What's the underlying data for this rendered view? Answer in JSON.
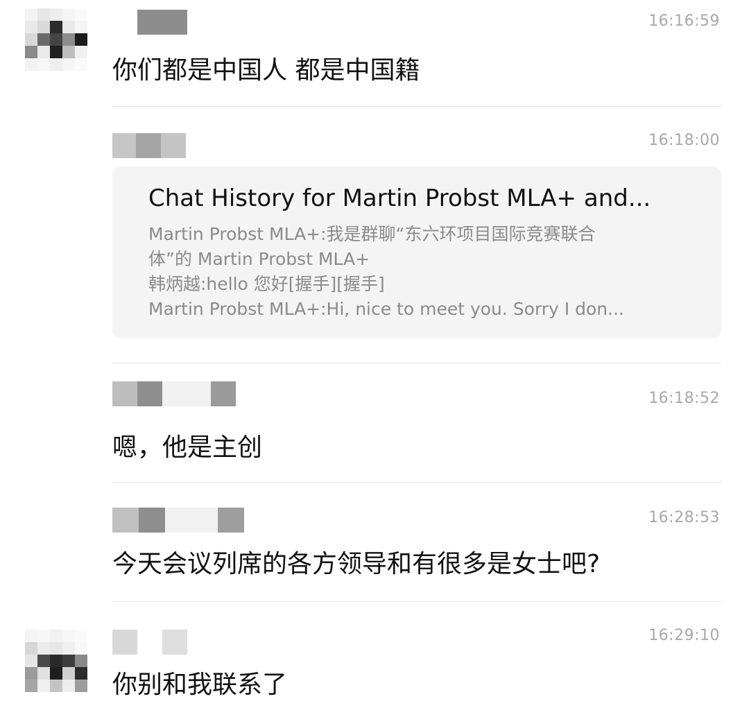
{
  "messages": [
    {
      "time": "16:16:59",
      "text": "你们都是中国人  都是中国籍"
    },
    {
      "time": "16:18:00",
      "card": {
        "title": "Chat History for Martin Probst MLA+ and...",
        "lines": [
          "Martin Probst MLA+:我是群聊“东六环项目国际竞赛联合",
          "体”的 Martin Probst MLA+",
          "韩炳越:hello  您好[握手][握手]",
          "Martin Probst MLA+:Hi, nice to meet you. Sorry I don..."
        ]
      }
    },
    {
      "time": "16:18:52",
      "text": "嗯，他是主创"
    },
    {
      "time": "16:28:53",
      "text": "今天会议列席的各方领导和有很多是女士吧?"
    },
    {
      "time": "16:29:10",
      "text": "你别和我联系了"
    }
  ],
  "colors": {
    "timestamp": "#a8a8a8",
    "message_text": "#111111",
    "card_background": "#f4f4f4",
    "card_subtext": "#8a8a8a",
    "divider": "#e3e3e3"
  }
}
